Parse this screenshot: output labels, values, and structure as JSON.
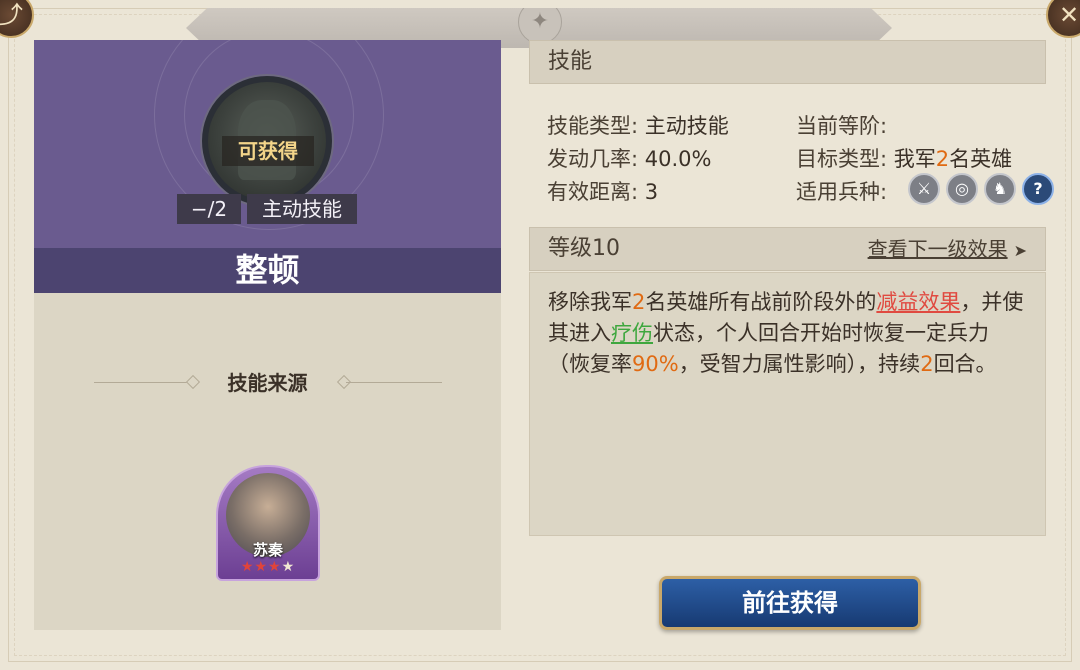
{
  "header": {
    "back_icon": "back-arrow-icon",
    "close_icon": "close-x-icon",
    "emblem": "✦"
  },
  "skill_card": {
    "status_tag": "可获得",
    "level_count": "−/2",
    "skill_type_tag": "主动技能",
    "name": "整顿"
  },
  "source": {
    "title": "技能来源",
    "hero": {
      "name": "苏秦",
      "stars_filled": 3,
      "stars_total": 4
    }
  },
  "skills_panel": {
    "title": "技能",
    "rows": {
      "skill_type_label": "技能类型:",
      "skill_type_value": "主动技能",
      "trigger_rate_label": "发动几率:",
      "trigger_rate_value": "40.0%",
      "range_label": "有效距离:",
      "range_value": "3",
      "current_level_label": "当前等阶:",
      "current_level_value": "",
      "target_label": "目标类型:",
      "target_prefix": "我军",
      "target_count": "2",
      "target_suffix": "名英雄",
      "unit_label": "适用兵种:"
    },
    "unit_icons": [
      "sword-icon",
      "target-icon",
      "horse-icon",
      "question-icon"
    ]
  },
  "level_panel": {
    "title": "等级10",
    "next_link": "查看下一级效果",
    "next_arrow": "➤"
  },
  "description": {
    "p1": "移除我军",
    "n1": "2",
    "p2": "名英雄所有战前阶段外的",
    "debuff": "减益效果",
    "p3": "，并使其进入",
    "heal": "疗伤",
    "p4": "状态，个人回合开始时恢复一定兵力（恢复率",
    "rate": "90%",
    "p5": "，受智力属性影响），持续",
    "n2": "2",
    "p6": "回合。"
  },
  "actions": {
    "go_button": "前往获得"
  },
  "colors": {
    "banner_purple": "#6a5b8f",
    "name_bar": "#4c4470",
    "highlight_orange": "#e06a12",
    "debuff_red": "#e04a40",
    "heal_green": "#3ea73e",
    "button_blue": "#2d5fa6"
  }
}
